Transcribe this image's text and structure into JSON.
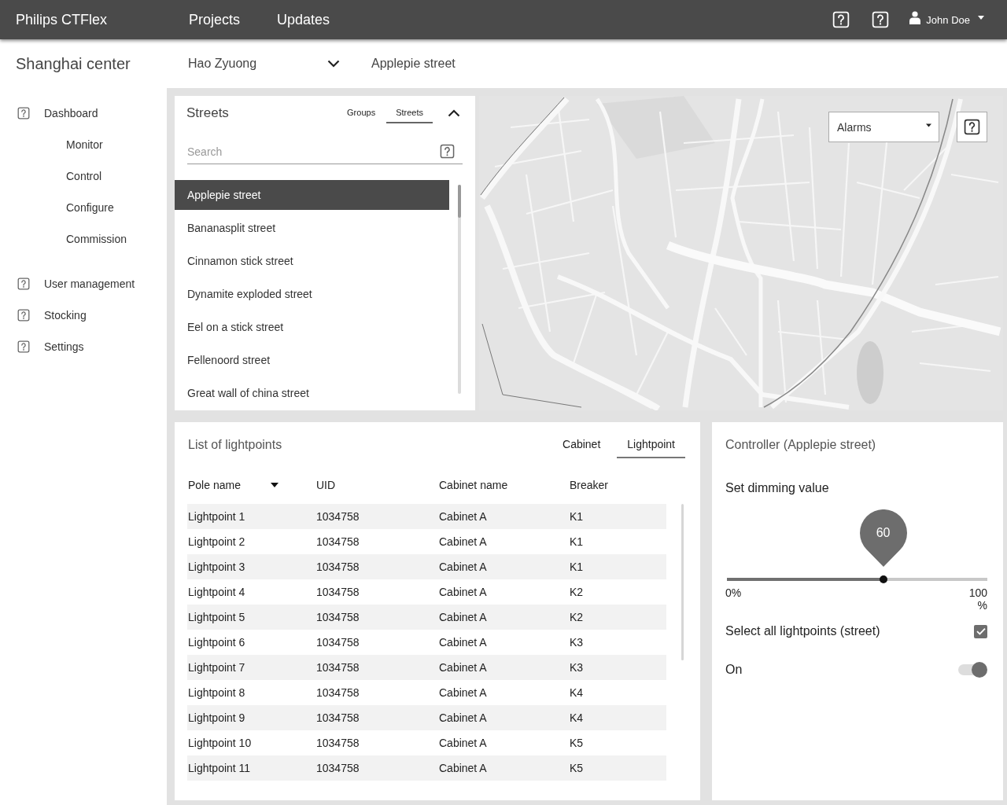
{
  "top_bar": {
    "brand": "Philips CTFlex",
    "nav": [
      {
        "label": "Projects"
      },
      {
        "label": "Updates"
      }
    ],
    "user": {
      "name": "John Doe"
    }
  },
  "sub_header": {
    "location": "Shanghai center",
    "person_select": {
      "value": "Hao Zyuong"
    },
    "street": "Applepie street"
  },
  "sidebar": {
    "items": [
      {
        "label": "Dashboard",
        "children": [
          {
            "label": "Monitor"
          },
          {
            "label": "Control"
          },
          {
            "label": "Configure"
          },
          {
            "label": "Commission"
          }
        ]
      },
      {
        "label": "User management"
      },
      {
        "label": "Stocking"
      },
      {
        "label": "Settings"
      }
    ]
  },
  "streets_panel": {
    "title": "Streets",
    "tabs": [
      {
        "label": "Groups",
        "selected": false
      },
      {
        "label": "Streets",
        "selected": true
      }
    ],
    "expanded": true,
    "search": {
      "placeholder": "Search"
    },
    "items": [
      {
        "label": "Applepie street",
        "selected": true
      },
      {
        "label": "Bananasplit street",
        "selected": false
      },
      {
        "label": "Cinnamon stick street",
        "selected": false
      },
      {
        "label": "Dynamite exploded street",
        "selected": false
      },
      {
        "label": "Eel on a stick street",
        "selected": false
      },
      {
        "label": "Fellenoord street",
        "selected": false
      },
      {
        "label": "Great wall of china street",
        "selected": false
      }
    ]
  },
  "map": {
    "filter": {
      "value": "Alarms"
    }
  },
  "lightpoints": {
    "title": "List of lightpoints",
    "tabs": [
      {
        "label": "Cabinet",
        "selected": false
      },
      {
        "label": "Lightpoint",
        "selected": true
      }
    ],
    "table": {
      "columns": [
        {
          "label": "Pole name",
          "sorted": true
        },
        {
          "label": "UID",
          "sorted": false
        },
        {
          "label": "Cabinet name",
          "sorted": false
        },
        {
          "label": "Breaker",
          "sorted": false
        }
      ],
      "rows": [
        [
          "Lightpoint 1",
          "1034758",
          "Cabinet A",
          "K1"
        ],
        [
          "Lightpoint 2",
          "1034758",
          "Cabinet A",
          "K1"
        ],
        [
          "Lightpoint 3",
          "1034758",
          "Cabinet A",
          "K1"
        ],
        [
          "Lightpoint 4",
          "1034758",
          "Cabinet A",
          "K2"
        ],
        [
          "Lightpoint 5",
          "1034758",
          "Cabinet A",
          "K2"
        ],
        [
          "Lightpoint 6",
          "1034758",
          "Cabinet A",
          "K3"
        ],
        [
          "Lightpoint 7",
          "1034758",
          "Cabinet A",
          "K3"
        ],
        [
          "Lightpoint 8",
          "1034758",
          "Cabinet A",
          "K4"
        ],
        [
          "Lightpoint 9",
          "1034758",
          "Cabinet A",
          "K4"
        ],
        [
          "Lightpoint 10",
          "1034758",
          "Cabinet A",
          "K5"
        ],
        [
          "Lightpoint 11",
          "1034758",
          "Cabinet A",
          "K5"
        ]
      ]
    }
  },
  "controller": {
    "title": "Controller (Applepie street)",
    "dimming": {
      "label": "Set dimming value",
      "reading": "60",
      "level": 0.6,
      "min_label": "0%",
      "max_label": "100%"
    },
    "select_all": {
      "label": "Select all lightpoints (street)",
      "checked": true
    },
    "power": {
      "label": "On",
      "on": true
    }
  }
}
